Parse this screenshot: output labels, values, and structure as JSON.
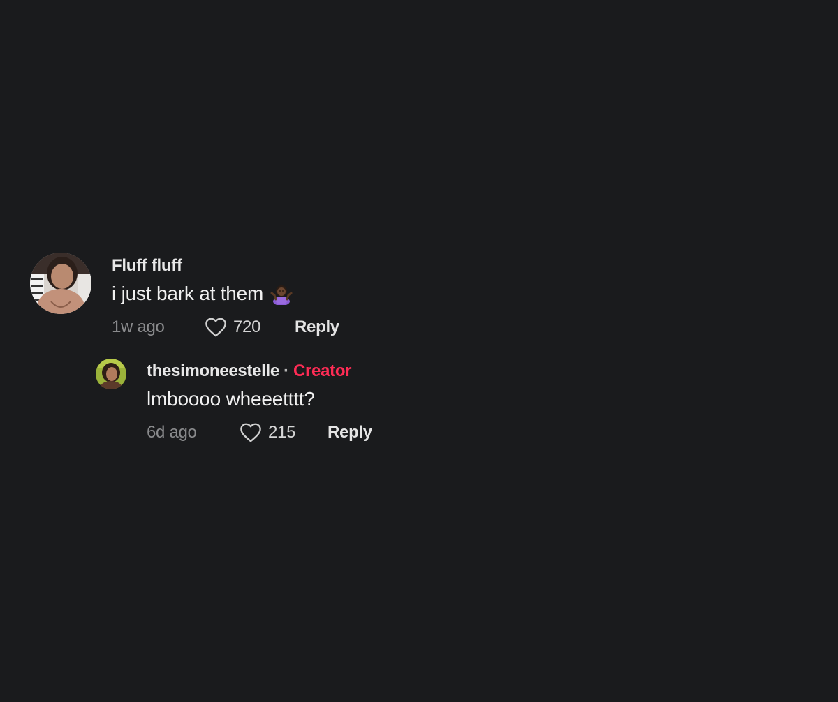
{
  "comments": [
    {
      "username": "Fluff fluff",
      "text": "i just bark at them",
      "emoji": "person-shrugging-emoji",
      "time": "1w ago",
      "likes": "720",
      "reply_label": "Reply"
    }
  ],
  "reply": {
    "username": "thesimoneestelle",
    "separator": "·",
    "badge": "Creator",
    "text": "lmboooo wheeetttt?",
    "time": "6d ago",
    "likes": "215",
    "reply_label": "Reply"
  },
  "colors": {
    "background": "#1a1b1d",
    "creator_badge": "#fe2c55",
    "muted": "#8a8b8d"
  }
}
